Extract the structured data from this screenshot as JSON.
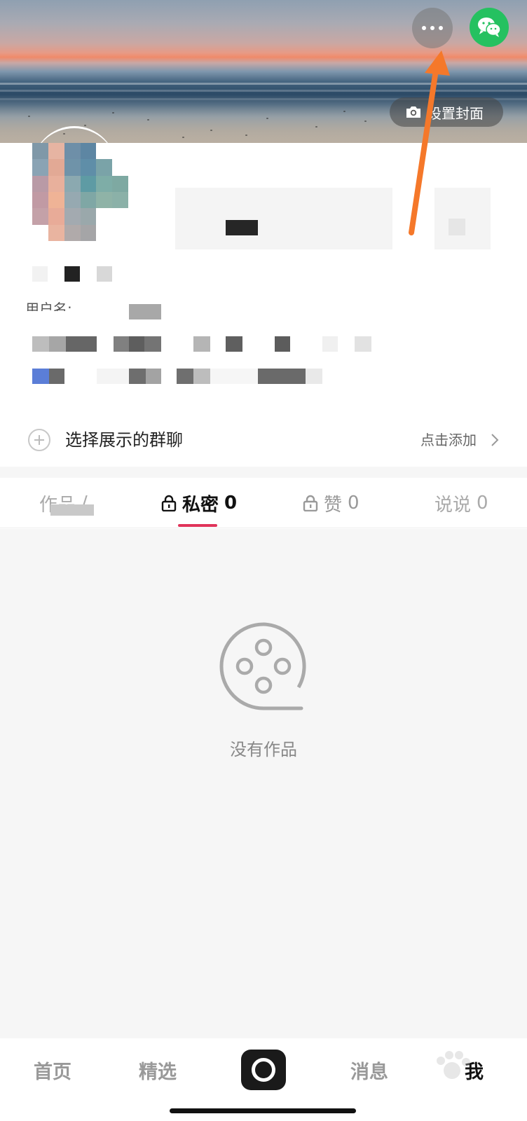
{
  "header": {
    "set_cover_label": "设置封面"
  },
  "profile": {
    "username_label": "用户名: "
  },
  "group_chat": {
    "label": "选择展示的群聊",
    "action_label": "点击添加"
  },
  "tabs": [
    {
      "label": "作品",
      "count": "/"
    },
    {
      "label": "私密",
      "count": "0"
    },
    {
      "label": "赞",
      "count": "0"
    },
    {
      "label": "说说",
      "count": "0"
    }
  ],
  "empty_state": {
    "text": "没有作品"
  },
  "bottom_nav": {
    "items": [
      "首页",
      "精选",
      "消息",
      "我"
    ]
  },
  "colors": {
    "accent": "#e0345a",
    "wechat_green": "#25c160",
    "annotation_arrow": "#f5782a"
  },
  "icons": [
    "more-icon",
    "wechat-icon",
    "camera-icon",
    "plus-icon",
    "chevron-right-icon",
    "lock-icon",
    "film-reel-icon"
  ]
}
